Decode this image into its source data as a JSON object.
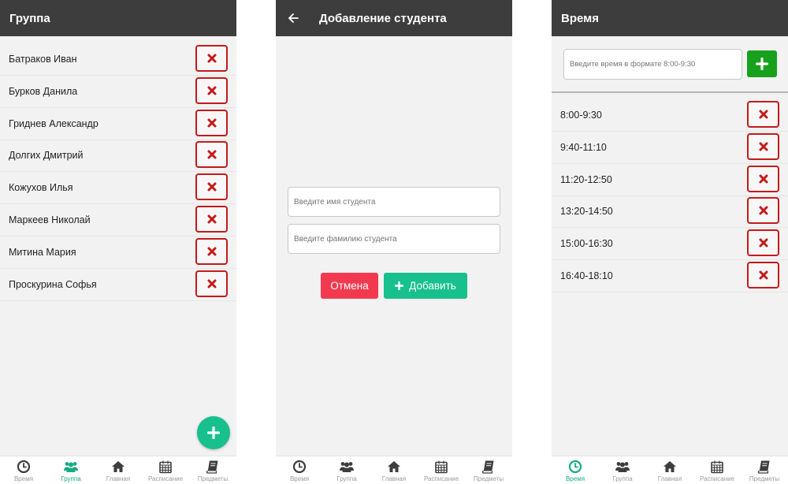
{
  "colors": {
    "appbar": "#3d3d3d",
    "accent": "#17c08c",
    "delete": "#c41a1a",
    "cancel": "#f3394f",
    "add_time": "#18a11c"
  },
  "group_screen": {
    "title": "Группа",
    "students": [
      "Батраков Иван",
      "Бурков Данила",
      "Гриднев Александр",
      "Долгих Дмитрий",
      "Кожухов Илья",
      "Маркеев Николай",
      "Митина Мария",
      "Проскурина Софья"
    ],
    "delete_icon": "x-icon",
    "fab_icon": "plus-icon"
  },
  "add_student_screen": {
    "title": "Добавление студента",
    "back_icon": "arrow-left-icon",
    "first_name_placeholder": "Введите имя студента",
    "last_name_placeholder": "Введите фамилию студента",
    "cancel_label": "Отмена",
    "add_label": "Добавить"
  },
  "time_screen": {
    "title": "Время",
    "input_placeholder": "Введите время в формате 8:00-9:30",
    "slots": [
      "8:00-9:30",
      "9:40-11:10",
      "11:20-12:50",
      "13:20-14:50",
      "15:00-16:30",
      "16:40-18:10"
    ]
  },
  "nav": {
    "items": [
      {
        "label": "Время",
        "icon": "clock-icon"
      },
      {
        "label": "Группа",
        "icon": "users-icon"
      },
      {
        "label": "Главная",
        "icon": "home-icon"
      },
      {
        "label": "Расписание",
        "icon": "calendar-icon"
      },
      {
        "label": "Предметы",
        "icon": "book-icon"
      }
    ],
    "active": {
      "group_screen": "Группа",
      "add_student_screen": "",
      "time_screen": "Время"
    }
  }
}
